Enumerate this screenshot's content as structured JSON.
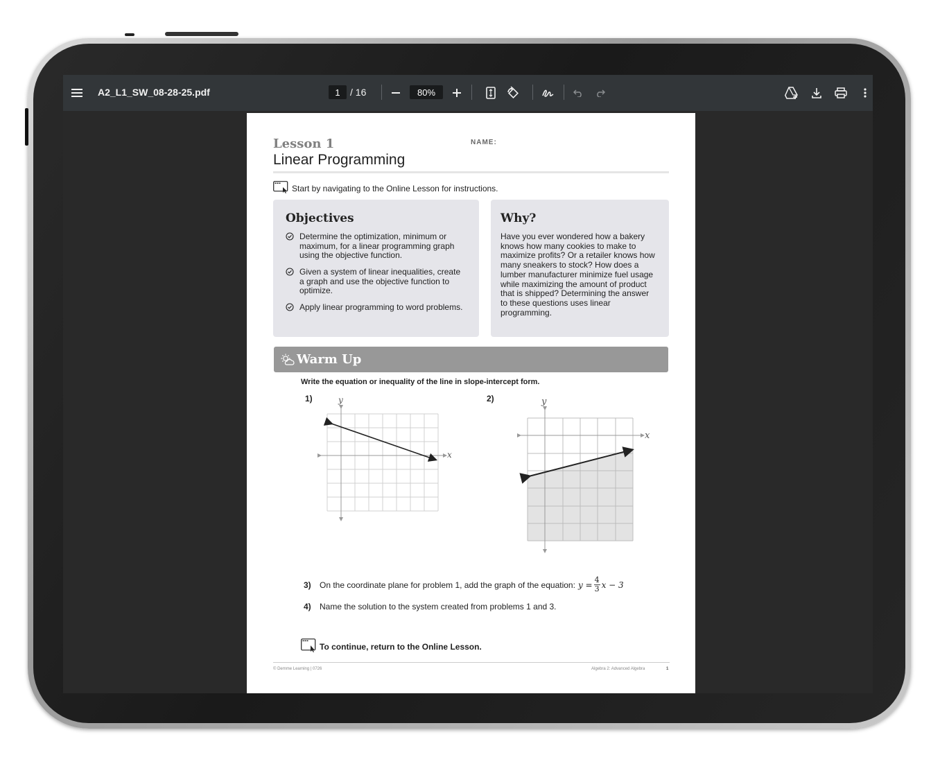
{
  "toolbar": {
    "filename": "A2_L1_SW_08-28-25.pdf",
    "page_current": "1",
    "page_total": "/ 16",
    "zoom": "80%",
    "icons": [
      "menu-icon",
      "zoom-out-icon",
      "zoom-in-icon",
      "fit-page-icon",
      "rotate-icon",
      "annotate-icon",
      "undo-icon",
      "redo-icon",
      "drive-icon",
      "download-icon",
      "print-icon",
      "more-icon"
    ]
  },
  "document": {
    "lesson_number": "Lesson 1",
    "lesson_title": "Linear Programming",
    "name_label": "NAME:",
    "start_instruction": "Start by navigating to the Online Lesson for instructions.",
    "objectives": {
      "heading": "Objectives",
      "items": [
        "Determine the optimization, minimum or maximum, for a linear programming graph using the objective function.",
        "Given a system of linear inequalities, create a graph and use the objective function to optimize.",
        "Apply linear programming to word problems."
      ]
    },
    "why": {
      "heading": "Why?",
      "text": "Have you ever wondered how a bakery knows how many cookies to make to maximize profits? Or a retailer knows how many sneakers to stock? How does a lumber manufacturer minimize fuel usage while maximizing the amount of product that is shipped? Determining the answer to these questions uses linear programming."
    },
    "warm_up": {
      "heading": "Warm Up",
      "instruction": "Write the equation or inequality of the line in slope-intercept form.",
      "problem1_label": "1)",
      "problem2_label": "2)",
      "axis_x": "x",
      "axis_y": "y",
      "q3_num": "3)",
      "q3_text": "On the coordinate plane for problem 1, add the graph of the equation:",
      "q3_eq_lhs": "y =",
      "q3_num_top": "4",
      "q3_num_bottom": "3",
      "q3_eq_rhs": "x − 3",
      "q4_num": "4)",
      "q4_text": "Name the solution to the system created from problems 1 and 3."
    },
    "continue_text": "To continue, return to the Online Lesson.",
    "footer_left": "© Demme Learning | 0726",
    "footer_right": "Algebra 2: Advanced Algebra",
    "footer_page": "1"
  },
  "colors": {
    "toolbar_bg": "#323639",
    "viewer_bg": "#292929",
    "box_bg": "#e5e5ea",
    "warmup_bar": "#989898"
  }
}
